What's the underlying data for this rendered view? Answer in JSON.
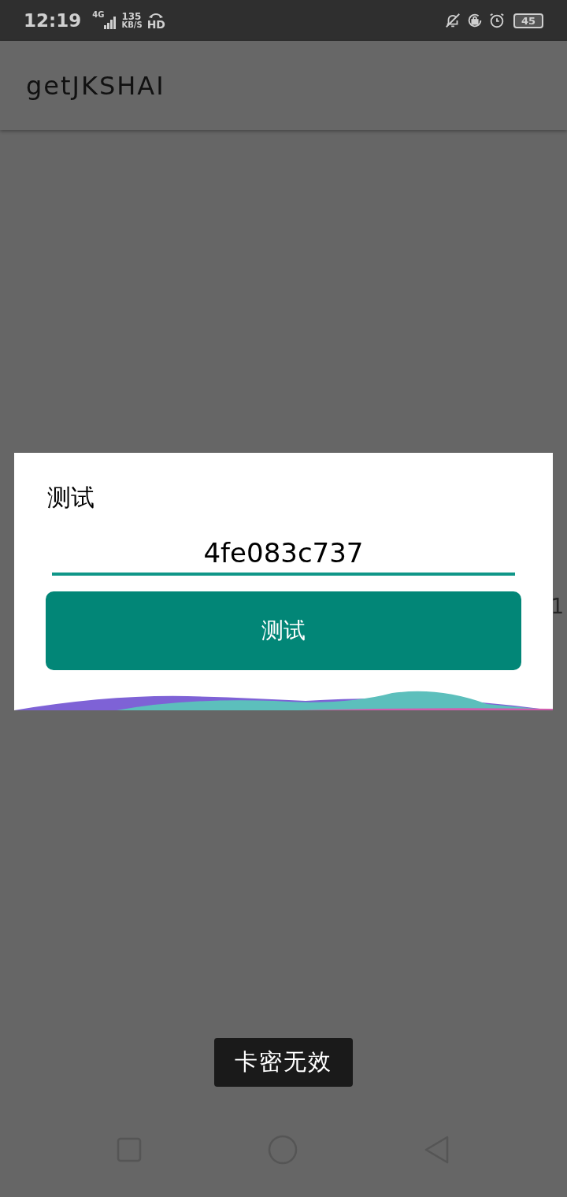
{
  "status_bar": {
    "time": "12:19",
    "network": "4G",
    "speed_value": "135",
    "speed_unit": "KB/S",
    "call_label": "HD",
    "battery": "45"
  },
  "app_bar": {
    "title": "getJKSHAI"
  },
  "background_text": "1",
  "dialog": {
    "title": "测试",
    "input": {
      "value": "4fe083c737"
    },
    "button": "测试"
  },
  "toast": "卡密无效"
}
